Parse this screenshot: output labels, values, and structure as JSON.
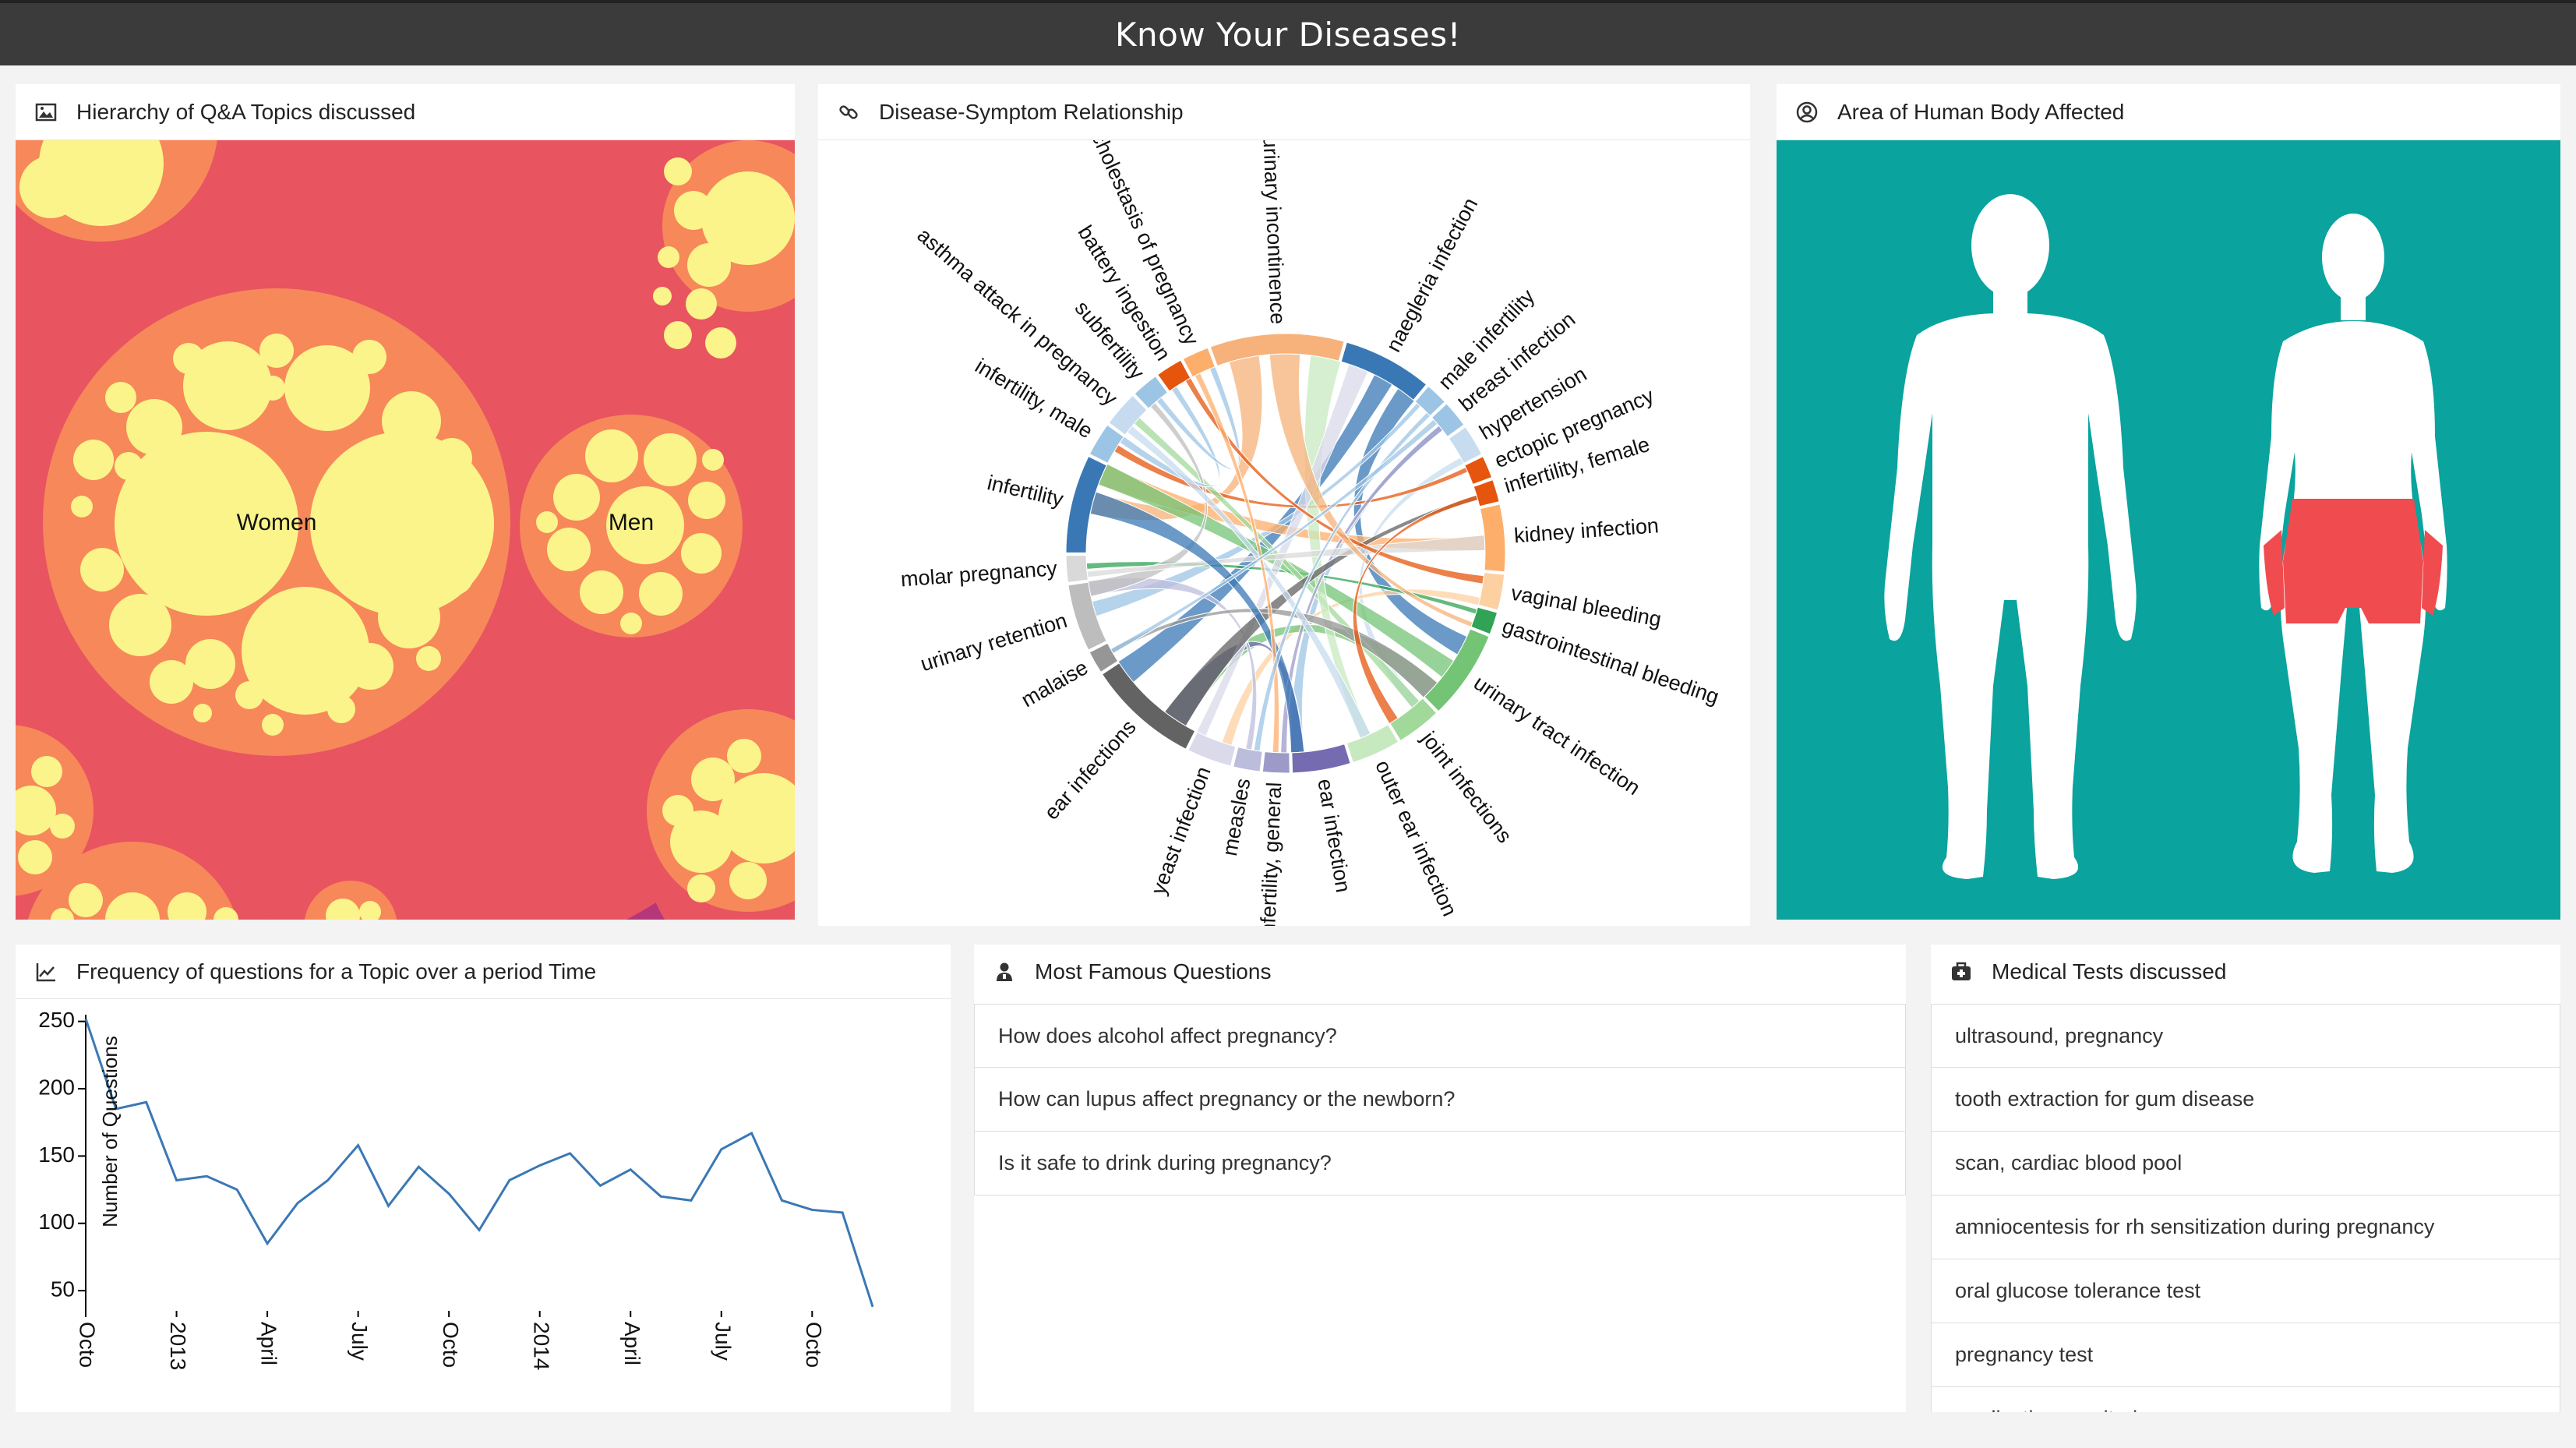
{
  "app": {
    "title": "Know Your Diseases!"
  },
  "colors": {
    "header_bg": "#3b3b3b",
    "teal": "#0aa39e",
    "highlight": "#f04b4f",
    "line": "#3a78b5"
  },
  "panels": {
    "hierarchy": {
      "title": "Hierarchy of Q&A Topics discussed",
      "icon": "image-icon",
      "labels": {
        "women": "Women",
        "men": "Men"
      }
    },
    "chord": {
      "title": "Disease-Symptom Relationship",
      "icon": "link-icon",
      "labels": [
        "urinary incontinence",
        "naegleria infection",
        "male infertility",
        "breast infection",
        "hypertension",
        "ectopic pregnancy",
        "infertility, female",
        "kidney infection",
        "vaginal bleeding",
        "gastrointestinal bleeding",
        "urinary tract infection",
        "joint infections",
        "outer ear infection",
        "ear infection",
        "infertility, general",
        "measles",
        "yeast infection",
        "ear infections",
        "malaise",
        "urinary retention",
        "molar pregnancy",
        "infertility",
        "infertility, male",
        "asthma attack in pregnancy",
        "subfertility",
        "battery ingestion",
        "cholestasis of pregnancy"
      ]
    },
    "body": {
      "title": "Area of Human Body Affected",
      "icon": "user-circle-icon"
    },
    "frequency": {
      "title": "Frequency of questions for a Topic over a period Time",
      "icon": "line-chart-icon"
    },
    "questions": {
      "title": "Most Famous Questions",
      "icon": "user-doctor-icon",
      "items": [
        "How does alcohol affect pregnancy?",
        "How can lupus affect pregnancy or the newborn?",
        "Is it safe to drink during pregnancy?"
      ]
    },
    "tests": {
      "title": "Medical Tests discussed",
      "icon": "medkit-icon",
      "items": [
        "ultrasound, pregnancy",
        "tooth extraction for gum disease",
        "scan, cardiac blood pool",
        "amniocentesis for rh sensitization during pregnancy",
        "oral glucose tolerance test",
        "pregnancy test",
        "medication monitoring"
      ]
    }
  },
  "chart_data": {
    "type": "line",
    "ylabel": "Number of Questions",
    "ylim": [
      35,
      255
    ],
    "yticks": [
      50,
      100,
      150,
      200,
      250
    ],
    "xticks": [
      "Octo",
      "2013",
      "April",
      "July",
      "Octo",
      "2014",
      "April",
      "July",
      "Octo"
    ],
    "x": [
      "2012-10",
      "2012-11",
      "2012-12",
      "2013-01",
      "2013-02",
      "2013-03",
      "2013-04",
      "2013-05",
      "2013-06",
      "2013-07",
      "2013-08",
      "2013-09",
      "2013-10",
      "2013-11",
      "2013-12",
      "2014-01",
      "2014-02",
      "2014-03",
      "2014-04",
      "2014-05",
      "2014-06",
      "2014-07",
      "2014-08",
      "2014-09",
      "2014-10",
      "2014-11",
      "2014-12"
    ],
    "values": [
      252,
      185,
      190,
      132,
      135,
      125,
      85,
      115,
      132,
      158,
      113,
      142,
      122,
      95,
      132,
      143,
      152,
      128,
      140,
      120,
      117,
      155,
      167,
      117,
      110,
      108,
      38
    ]
  }
}
